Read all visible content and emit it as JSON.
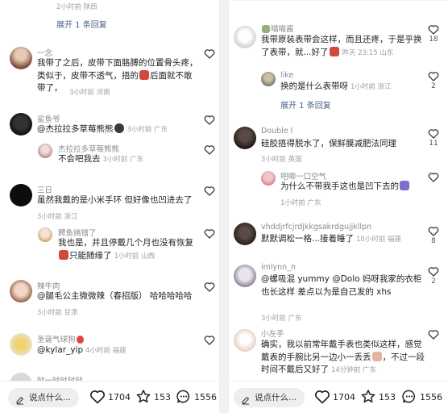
{
  "left": {
    "top_meta": "2小时前 陕西",
    "top_expand": "展开 1 条回复",
    "comments": [
      {
        "name": "一念",
        "text": "我带了之后，皮带下面胳膊的位置骨头疼，类似于，皮带不透气，捂的",
        "text_after": "后面就不敢带了，",
        "meta": "3小时前 河南"
      },
      {
        "name": "鲨鱼爷",
        "text": "@杰拉拉多草莓熊熊",
        "meta": "3小时前 广东"
      },
      {
        "name": "杰拉拉多草莓熊熊",
        "text": "不会吧我去",
        "meta": "3小时前 广东"
      },
      {
        "name": "三日",
        "text": "虽然我戴的是小米手环 但好像也凹进去了",
        "meta": "3小时前 浙江"
      },
      {
        "name": "鳄鱼搞错了",
        "text": "我也是，并且停戴几个月也没有恢复",
        "text_after": "只能随缘了",
        "meta": "1小时前 山西"
      },
      {
        "name": "辣牛肉",
        "text": "@腿毛公主微微辣（春招版） 哈哈哈哈哈",
        "meta": "3小时前 甘肃"
      },
      {
        "name": "圣诞气球狗",
        "text": "@kylar_yip",
        "meta": "4小时前 福建"
      },
      {
        "name": "哒一哒哒哒哒"
      }
    ]
  },
  "right": {
    "comments": [
      {
        "name": "喵喵酱",
        "text": "我带原装表带会这样，而且还疼，于是乎换了表带，就...好了",
        "meta": "昨天 23:15 山东",
        "likes": "18"
      },
      {
        "name": "like",
        "text": "换的是什么表带呀",
        "meta": "1小时前 浙江",
        "likes": "2"
      },
      {
        "expand": "展开 1 条回复"
      },
      {
        "name": "Double l",
        "text": "硅胶捂得脱水了，保鲜膜减肥法同理",
        "meta": "3小时前 英国",
        "likes": "11"
      },
      {
        "name": "吧唧一口空气",
        "text": "为什么不带我手这也是凹下去的",
        "meta": "1小时前 广东"
      },
      {
        "name": "vhddjrfcjrdjkkgsakrdgujjkllpn",
        "text": "默默调松一格...接着睡了",
        "meta": "10小时前 福建",
        "likes": "8"
      },
      {
        "name": "imlynn_n",
        "text": "@螺吸混 yummy @Dolo 妈呀我家的衣柜也长这样 差点以为是自己发的 xhs",
        "meta": "3小时前 广东",
        "likes": "2"
      },
      {
        "name": "小左手",
        "text": "确实，我以前常年戴手表也类似这样，感觉戴表的手腕比另一边小一丢丢",
        "text_after": "，不过一段时间不戴后又好了",
        "meta": "14分钟前 广东"
      }
    ]
  },
  "bottom_bar": {
    "input_placeholder": "说点什么...",
    "like_count": "1704",
    "star_count": "153",
    "comment_count": "1556"
  },
  "colors": {
    "link": "#4a5f86",
    "meta": "#a0a0a0",
    "pill_bg": "#eeeeee"
  },
  "icons": [
    "heart-icon",
    "star-icon",
    "comment-bubble-icon",
    "pen-icon"
  ]
}
